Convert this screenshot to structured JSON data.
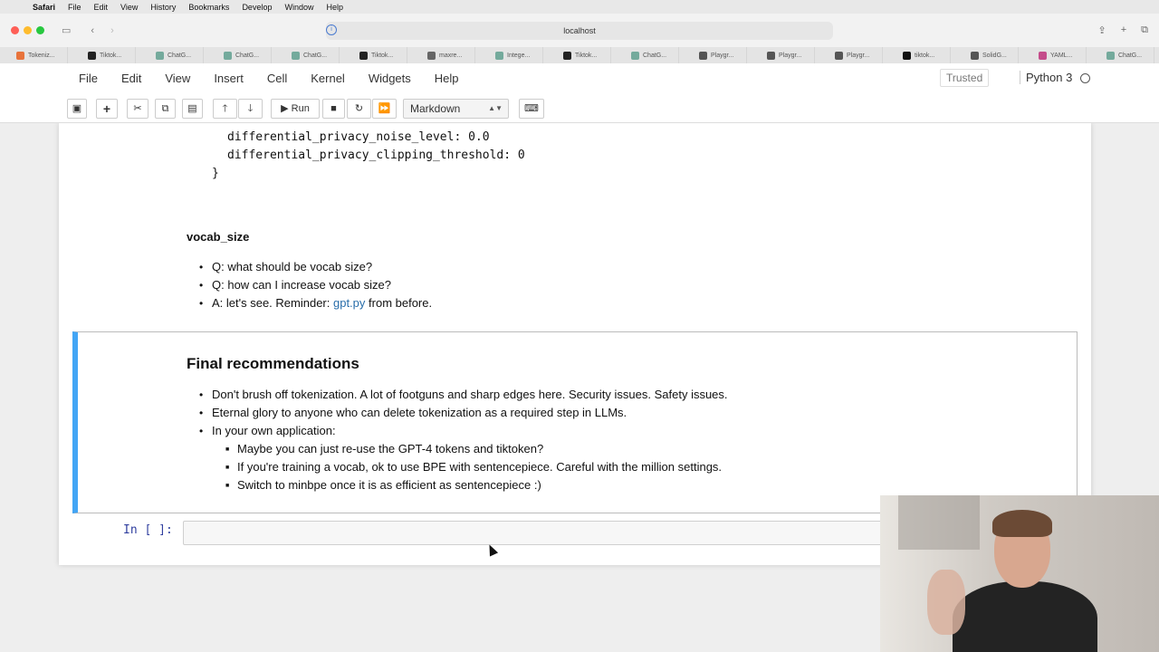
{
  "mac_menubar": {
    "items": [
      "Safari",
      "File",
      "Edit",
      "View",
      "History",
      "Bookmarks",
      "Develop",
      "Window",
      "Help"
    ]
  },
  "browser": {
    "url": "localhost",
    "tabs": [
      {
        "label": "Tokeniz...",
        "color": "#e8733b"
      },
      {
        "label": "Tiktok...",
        "color": "#222222"
      },
      {
        "label": "ChatG...",
        "color": "#74aa9c"
      },
      {
        "label": "ChatG...",
        "color": "#74aa9c"
      },
      {
        "label": "ChatG...",
        "color": "#74aa9c"
      },
      {
        "label": "Tiktok...",
        "color": "#222222"
      },
      {
        "label": "maxre...",
        "color": "#666666"
      },
      {
        "label": "Intege...",
        "color": "#74aa9c"
      },
      {
        "label": "Tiktok...",
        "color": "#222222"
      },
      {
        "label": "ChatG...",
        "color": "#74aa9c"
      },
      {
        "label": "Playgr...",
        "color": "#555555"
      },
      {
        "label": "Playgr...",
        "color": "#555555"
      },
      {
        "label": "Playgr...",
        "color": "#555555"
      },
      {
        "label": "tiktok...",
        "color": "#111111"
      },
      {
        "label": "SolidG...",
        "color": "#555555"
      },
      {
        "label": "YAML...",
        "color": "#c44c8a"
      },
      {
        "label": "ChatG...",
        "color": "#74aa9c"
      }
    ]
  },
  "jupyter": {
    "menu": [
      "File",
      "Edit",
      "View",
      "Insert",
      "Cell",
      "Kernel",
      "Widgets",
      "Help"
    ],
    "trusted": "Trusted",
    "kernel": "Python 3",
    "toolbar": {
      "run_label": "Run",
      "cell_type": "Markdown"
    }
  },
  "notebook": {
    "code_lines": [
      "differential_privacy_noise_level: 0.0",
      "differential_privacy_clipping_threshold: 0"
    ],
    "code_brace": "}",
    "vocab_heading": "vocab_size",
    "vocab_items": [
      "Q: what should be vocab size?",
      "Q: how can I increase vocab size?"
    ],
    "vocab_a_prefix": "A: let's see. Reminder: ",
    "vocab_a_link": "gpt.py",
    "vocab_a_suffix": " from before.",
    "final_heading": "Final recommendations",
    "final_items": [
      "Don't brush off tokenization. A lot of footguns and sharp edges here. Security issues. Safety issues.",
      "Eternal glory to anyone who can delete tokenization as a required step in LLMs.",
      "In your own application:"
    ],
    "final_subitems": [
      "Maybe you can just re-use the GPT-4 tokens and tiktoken?",
      "If you're training a vocab, ok to use BPE with sentencepiece. Careful with the million settings.",
      "Switch to minbpe once it is as efficient as sentencepiece :)"
    ],
    "prompt": "In [ ]:"
  }
}
